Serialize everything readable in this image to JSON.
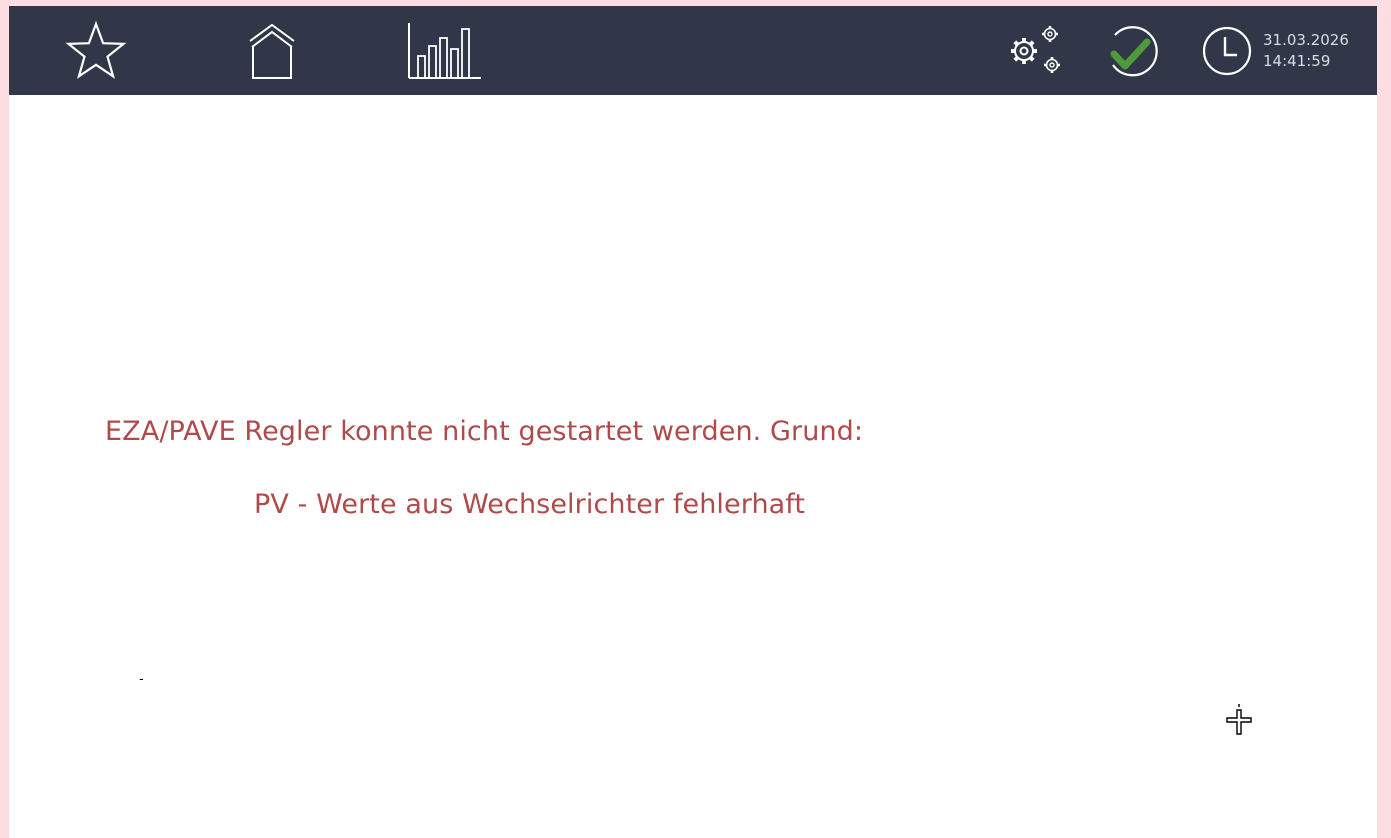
{
  "topbar": {
    "nav": [
      {
        "icon": "star-icon",
        "name": "favorites"
      },
      {
        "icon": "home-icon",
        "name": "home"
      },
      {
        "icon": "bar-chart-icon",
        "name": "statistics"
      }
    ],
    "settings_icon": "gears-icon",
    "status_icon": "check-circle-icon",
    "status_color": "#4e9a3c",
    "clock_icon": "clock-icon",
    "date": "31.03.2026",
    "time": "14:41:59"
  },
  "main": {
    "error_line_1": "EZA/PAVE Regler konnte nicht gestartet werden. Grund:",
    "error_line_2": "PV - Werte aus Wechselrichter fehlerhaft",
    "stray_mark": "-",
    "error_color": "#b04a4a"
  },
  "colors": {
    "topbar_bg": "#2f3748",
    "icon_stroke": "#ffffff",
    "page_bg": "#ffffff",
    "frame_bg": "#fbdde2"
  }
}
